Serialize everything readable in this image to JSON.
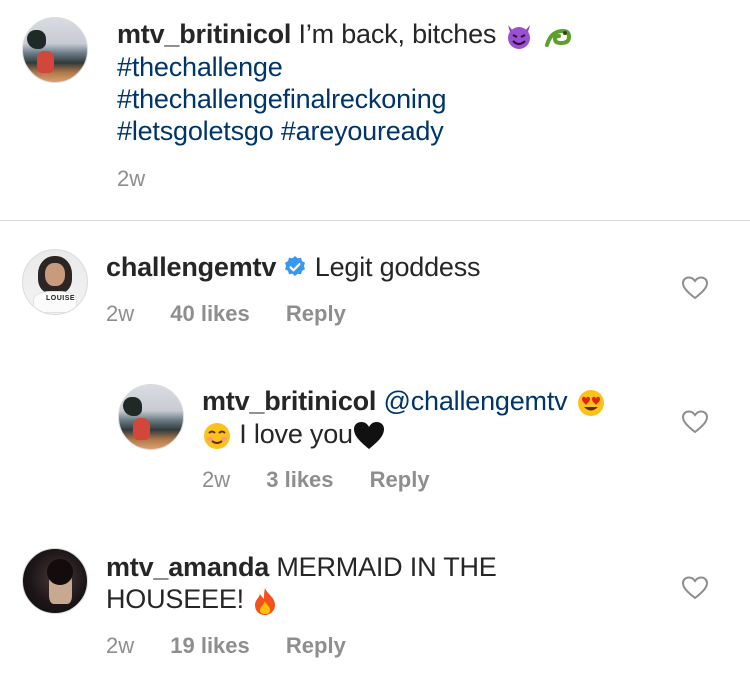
{
  "post": {
    "username": "mtv_britinicol",
    "caption": " I’m back, bitches",
    "hashtags": [
      "#thechallenge",
      "#thechallengefinalreckoning",
      "#letsgoletsgo",
      "#areyouready"
    ],
    "time": "2w",
    "emojis": [
      "smiling-devil-emoji",
      "dragon-emoji"
    ]
  },
  "comments": [
    {
      "username": "challengemtv",
      "verified": true,
      "text": " Legit goddess",
      "time": "2w",
      "likes": "40 likes",
      "reply": "Reply"
    },
    {
      "username": "mtv_britinicol",
      "mention": " @challengemtv",
      "text": " I love you",
      "time": "2w",
      "likes": "3 likes",
      "reply": "Reply",
      "emojis": [
        "heart-eyes-emoji",
        "smiling-blush-emoji",
        "black-heart-emoji"
      ]
    },
    {
      "username": "mtv_amanda",
      "text_line1": " MERMAID IN THE",
      "text_line2": "HOUSEEE! ",
      "time": "2w",
      "likes": "19 likes",
      "reply": "Reply",
      "emojis": [
        "fire-emoji"
      ]
    }
  ],
  "avatar_shirt_text": "LOUISE"
}
